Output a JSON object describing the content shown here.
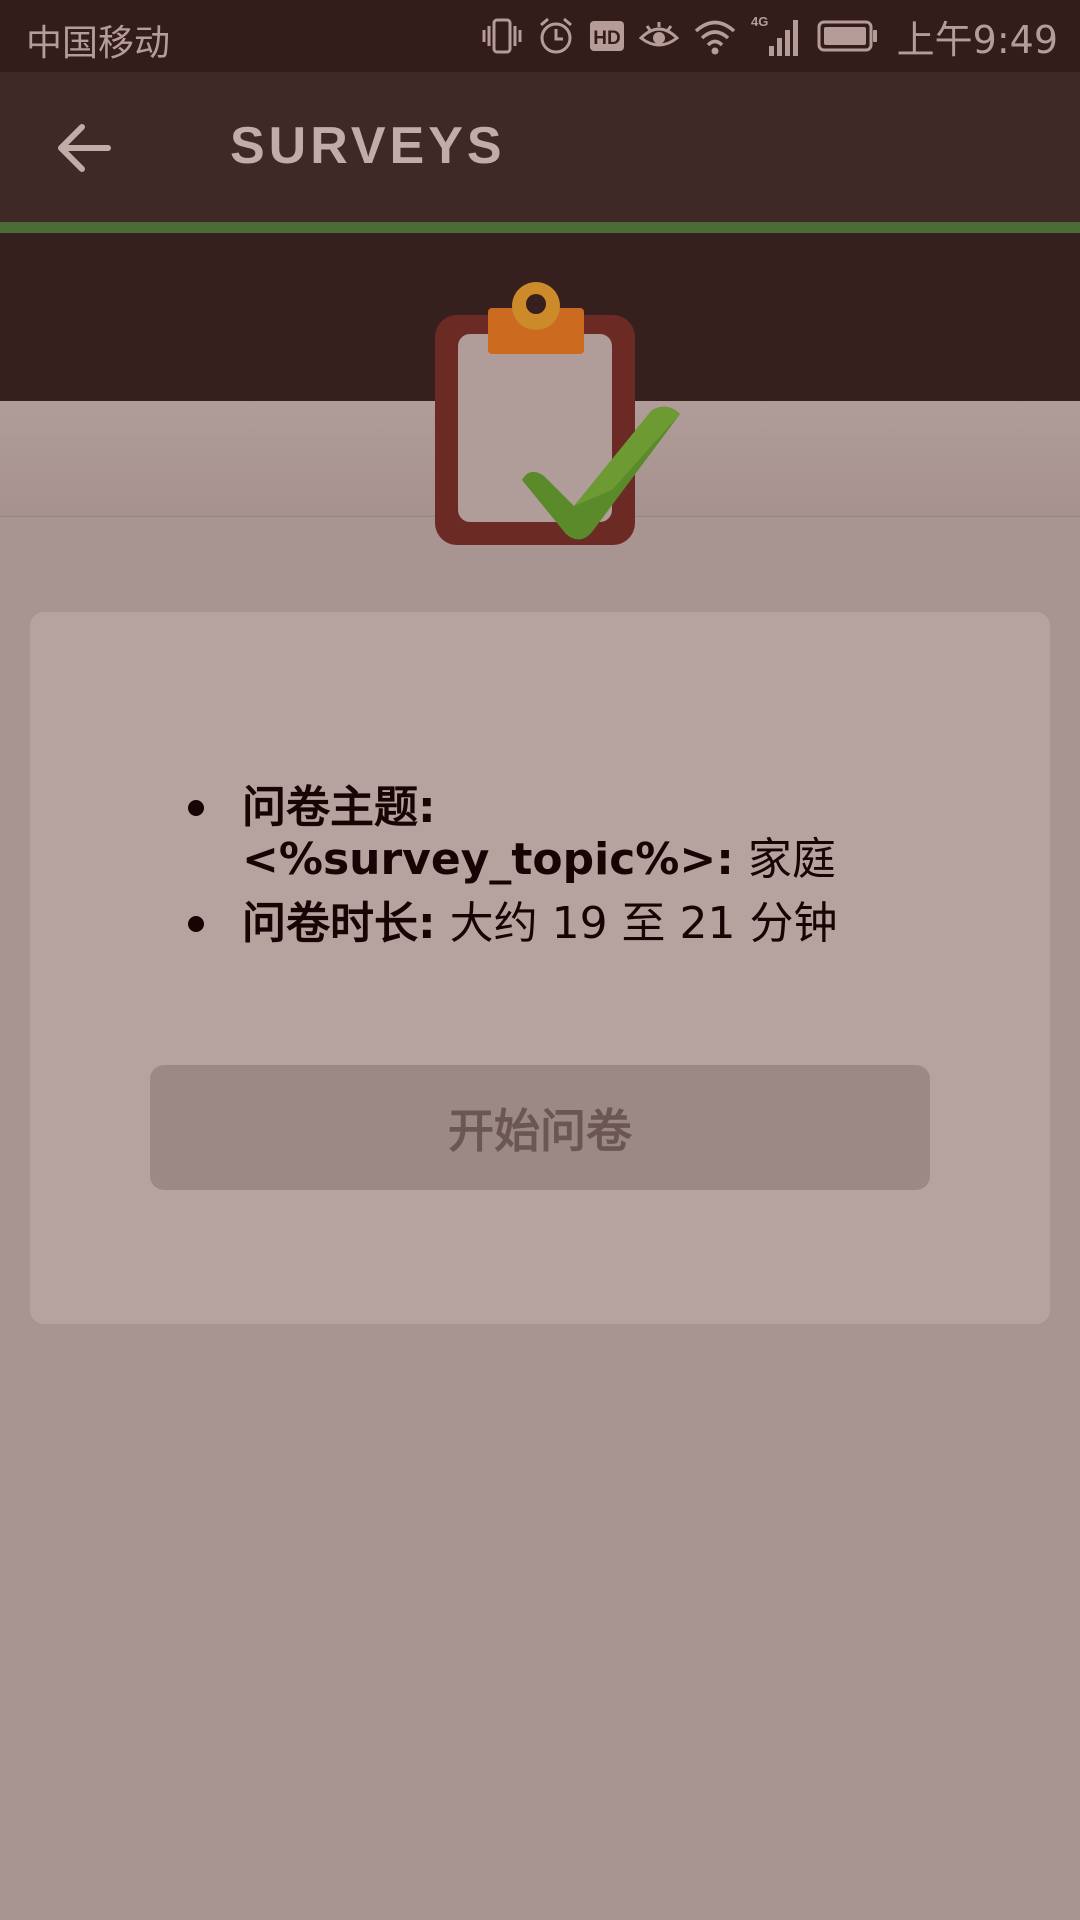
{
  "status_bar": {
    "carrier": "中国移动",
    "hd_badge": "HD",
    "network_type": "4G",
    "time": "上午9:49",
    "icons": [
      "vibrate-icon",
      "alarm-icon",
      "hd-icon",
      "eye-icon",
      "wifi-icon",
      "signal-icon",
      "battery-icon"
    ]
  },
  "app_bar": {
    "title": "SURVEYS",
    "back_icon": "arrow-left-icon"
  },
  "hero": {
    "icon": "clipboard-check-icon"
  },
  "survey": {
    "items": [
      {
        "label": "问卷主题: <%survey_topic%>:",
        "value": " 家庭"
      },
      {
        "label": "问卷时长:",
        "value": " 大约 19 至 21 分钟"
      }
    ],
    "start_button": "开始问卷"
  },
  "colors": {
    "status_bar_bg": "#331d1a",
    "app_bar_bg": "#3f2926",
    "accent_green": "#4b6c36",
    "page_bg": "#a89592",
    "card_bg": "#b6a39f",
    "button_bg": "#9c8884"
  }
}
